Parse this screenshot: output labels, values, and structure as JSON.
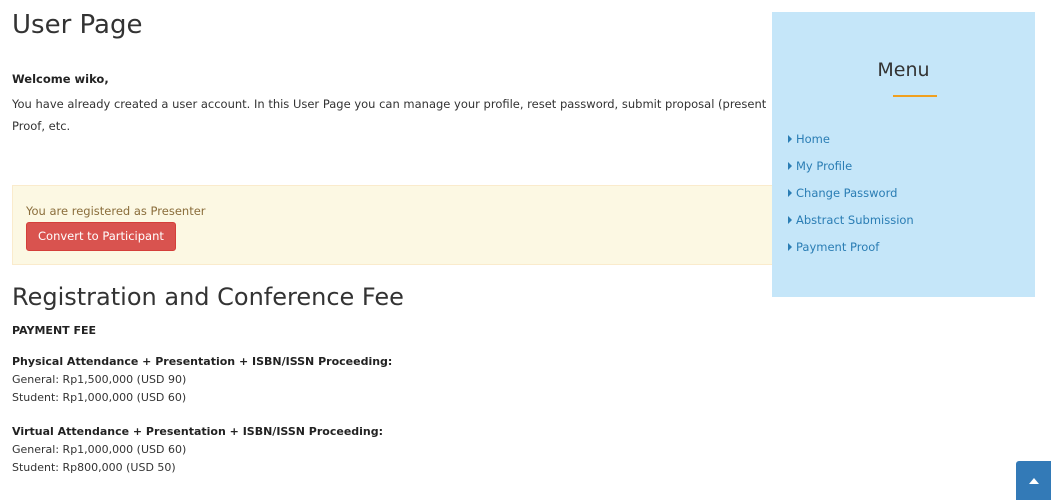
{
  "page": {
    "title": "User Page",
    "welcome": "Welcome wiko,",
    "intro_line1": "You have already created a user account. In this User Page you can manage your profile, reset password, submit proposal (present",
    "intro_line2": "Proof, etc."
  },
  "alert": {
    "text": "You are registered as Presenter",
    "button_label": "Convert to Participant"
  },
  "fees": {
    "title": "Registration and Conference Fee",
    "payment_fee_label": "PAYMENT FEE",
    "physical": {
      "heading": "Physical Attendance + Presentation + ISBN/ISSN Proceeding:",
      "general": "General: Rp1,500,000 (USD 90)",
      "student": "Student: Rp1,000,000 (USD 60)"
    },
    "virtual": {
      "heading": "Virtual Attendance + Presentation + ISBN/ISSN Proceeding:",
      "general": "General: Rp1,000,000 (USD 60)",
      "student": "Student: Rp800,000 (USD 50)"
    }
  },
  "menu": {
    "title": "Menu",
    "items": [
      {
        "label": "Home"
      },
      {
        "label": "My Profile"
      },
      {
        "label": "Change Password"
      },
      {
        "label": "Abstract Submission"
      },
      {
        "label": "Payment Proof"
      }
    ]
  },
  "colors": {
    "menu_bg": "#c5e6f9",
    "accent": "#f0a020",
    "link": "#2a7db4",
    "danger": "#d9534f",
    "alert_bg": "#fcf8e3"
  },
  "icons": {
    "menu_bullet": "caret-right-icon",
    "scroll_top": "chevron-up-icon"
  }
}
